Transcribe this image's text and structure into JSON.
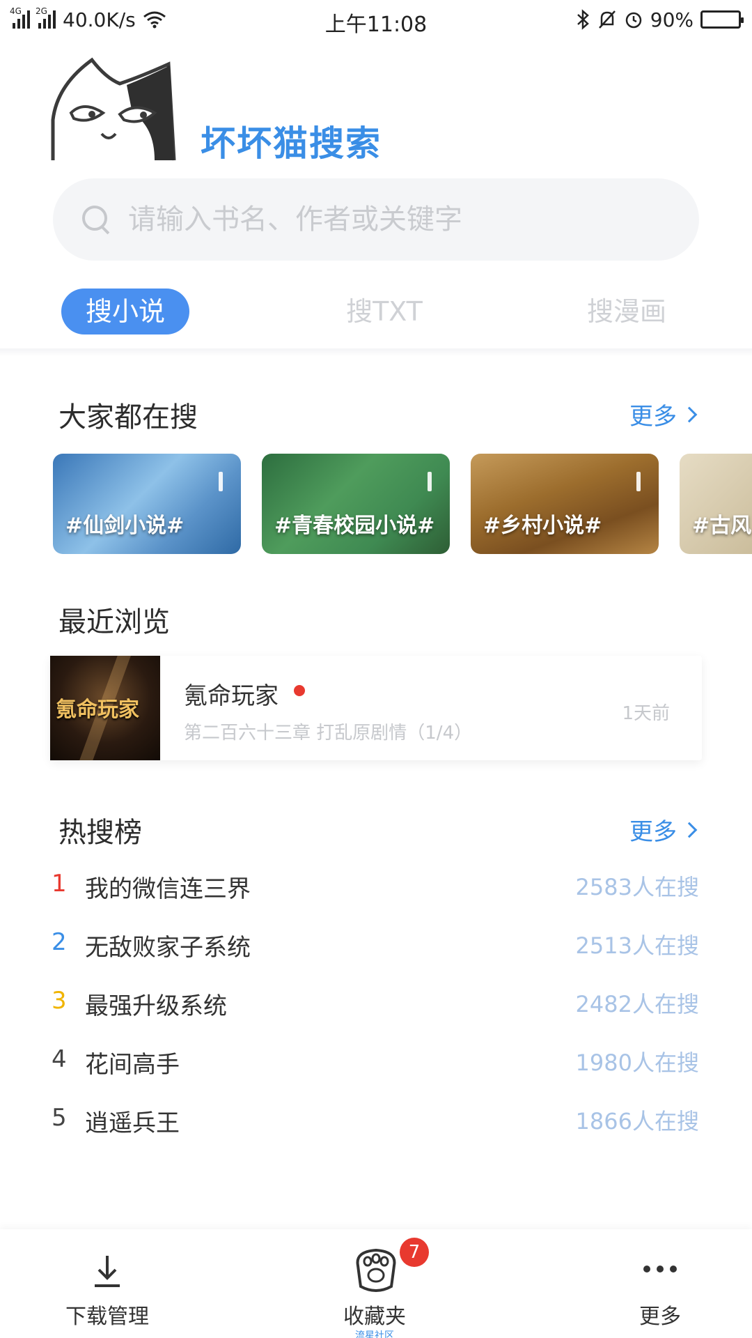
{
  "status_bar": {
    "net_left": "4G",
    "net_right": "2G",
    "speed": "40.0K/s",
    "time": "上午11:08",
    "battery": "90%",
    "battery_level": 0.9
  },
  "header": {
    "brand": "坏坏猫搜索"
  },
  "search": {
    "placeholder": "请输入书名、作者或关键字"
  },
  "tabs": [
    {
      "label": "搜小说",
      "active": true
    },
    {
      "label": "搜TXT",
      "active": false
    },
    {
      "label": "搜漫画",
      "active": false
    }
  ],
  "trending": {
    "title": "大家都在搜",
    "more": "更多",
    "cards": [
      {
        "label": "#仙剑小说#"
      },
      {
        "label": "#青春校园小说#"
      },
      {
        "label": "#乡村小说#"
      },
      {
        "label": "#古风"
      }
    ]
  },
  "recent": {
    "title": "最近浏览",
    "item": {
      "cover_text": "氪命玩家",
      "book_title": "氪命玩家",
      "chapter": "第二百六十三章 打乱原剧情（1/4）",
      "time_ago": "1天前"
    }
  },
  "hot": {
    "title": "热搜榜",
    "more": "更多",
    "items": [
      {
        "rank": "1",
        "name": "我的微信连三界",
        "count": "2583人在搜",
        "rank_color": "#e8392f"
      },
      {
        "rank": "2",
        "name": "无敌败家子系统",
        "count": "2513人在搜",
        "rank_color": "#3a8ee6"
      },
      {
        "rank": "3",
        "name": "最强升级系统",
        "count": "2482人在搜",
        "rank_color": "#f0b400"
      },
      {
        "rank": "4",
        "name": "花间高手",
        "count": "1980人在搜",
        "rank_color": "#444444"
      },
      {
        "rank": "5",
        "name": "逍遥兵王",
        "count": "1866人在搜",
        "rank_color": "#444444"
      }
    ]
  },
  "bottom_nav": {
    "download": "下载管理",
    "favorites": "收藏夹",
    "favorites_sub": "流星社区",
    "favorites_badge": "7",
    "more": "更多"
  },
  "colors": {
    "accent": "#3a8ee6",
    "tab_active_bg": "#4a90f0",
    "badge": "#e8392f"
  }
}
